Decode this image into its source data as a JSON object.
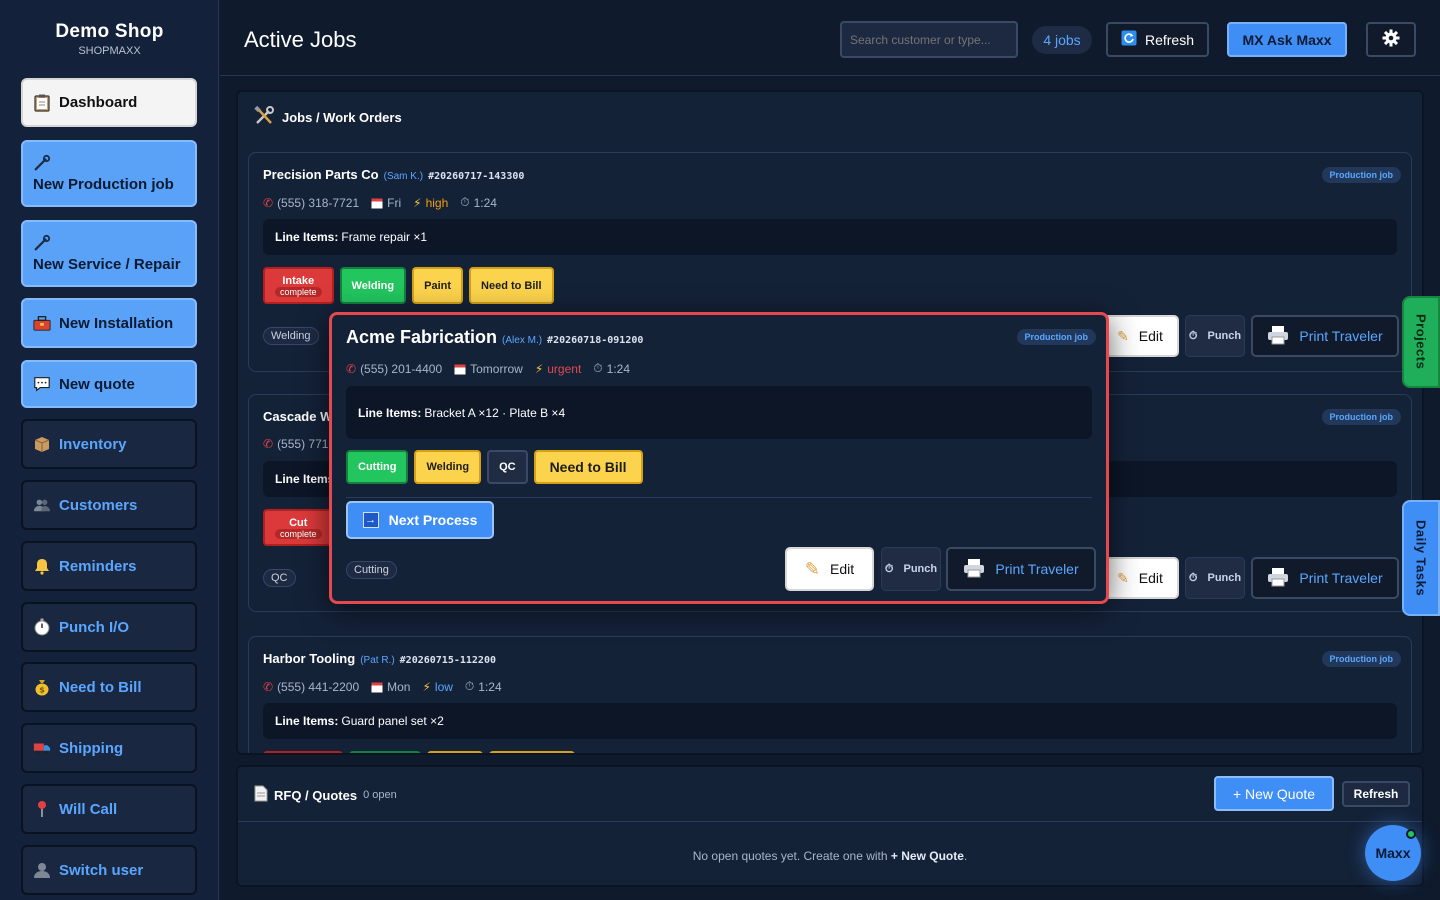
{
  "brand": {
    "name": "Demo Shop",
    "sub": "SHOPMAXX"
  },
  "sidebar": {
    "items": [
      {
        "label": "Dashboard",
        "icon": "clipboard-icon"
      },
      {
        "label": "New Production job",
        "icon": "wrench-icon"
      },
      {
        "label": "New Service / Repair",
        "icon": "wrench-icon"
      },
      {
        "label": "New Installation",
        "icon": "toolbox-icon"
      },
      {
        "label": "New quote",
        "icon": "chat-icon"
      },
      {
        "label": "Inventory",
        "icon": "box-icon"
      },
      {
        "label": "Customers",
        "icon": "users-icon"
      },
      {
        "label": "Reminders",
        "icon": "bell-icon"
      },
      {
        "label": "Punch I/O",
        "icon": "stopwatch-icon"
      },
      {
        "label": "Need to Bill",
        "icon": "moneybag-icon"
      },
      {
        "label": "Shipping",
        "icon": "truck-icon"
      },
      {
        "label": "Will Call",
        "icon": "pin-icon"
      },
      {
        "label": "Switch user",
        "icon": "user-icon"
      }
    ]
  },
  "header": {
    "title": "Active Jobs",
    "search_placeholder": "Search customer or type...",
    "jobs_count": "4 jobs",
    "refresh": "Refresh",
    "ask": "MX Ask Maxx"
  },
  "jobs_panel": {
    "title": "Jobs / Work Orders"
  },
  "common": {
    "edit": "Edit",
    "punch": "Punch",
    "print": "Print Traveler",
    "line_items_label": "Line Items:"
  },
  "cards": [
    {
      "name": "Precision Parts Co",
      "contact": "(Sam K.)",
      "id": "#20260717-143300",
      "badge": "Production job",
      "phone": "(555) 318-7721",
      "day": "Fri",
      "priority": "high",
      "time": "1:24",
      "line_items": "Frame repair ×1",
      "chips": [
        {
          "label": "Intake",
          "sub": "complete"
        },
        {
          "label": "Welding"
        },
        {
          "label": "Paint"
        },
        {
          "label": "Need to Bill"
        }
      ],
      "tag": "Welding"
    },
    {
      "name": "Cascade We",
      "contact": "",
      "id": "",
      "badge": "Production job",
      "phone": "(555) 771",
      "line_items_label": "Line Items",
      "chips": [
        {
          "label": "Cut",
          "sub": "complete"
        }
      ],
      "tag": "QC"
    },
    {
      "name": "Harbor Tooling",
      "contact": "(Pat R.)",
      "id": "#20260715-112200",
      "badge": "Production job",
      "phone": "(555) 441-2200",
      "day": "Mon",
      "priority": "low",
      "time": "1:24",
      "line_items": "Guard panel set ×2"
    }
  ],
  "modal": {
    "name": "Acme Fabrication",
    "contact": "(Alex M.)",
    "id": "#20260718-091200",
    "badge": "Production job",
    "phone": "(555) 201-4400",
    "day": "Tomorrow",
    "priority": "urgent",
    "time": "1:24",
    "line_items": "Bracket A ×12 · Plate B ×4",
    "chips": [
      {
        "label": "Cutting"
      },
      {
        "label": "Welding"
      },
      {
        "label": "QC"
      },
      {
        "label": "Need to Bill"
      }
    ],
    "next_process": "Next Process",
    "tag": "Cutting"
  },
  "side_tabs": {
    "projects": "Projects",
    "daily": "Daily Tasks"
  },
  "rfq": {
    "title": "RFQ / Quotes",
    "open": "0 open",
    "new_quote": "+ New Quote",
    "refresh": "Refresh",
    "empty_prefix": "No open quotes yet. Create one with",
    "empty_strong": "+ New Quote",
    "empty_suffix": "."
  },
  "maxx": "Maxx",
  "colors": {
    "accent": "#3f8ef5",
    "danger": "#e5484d",
    "success": "#22c55e",
    "warning": "#fcd34d",
    "background": "#0f1b2d"
  }
}
